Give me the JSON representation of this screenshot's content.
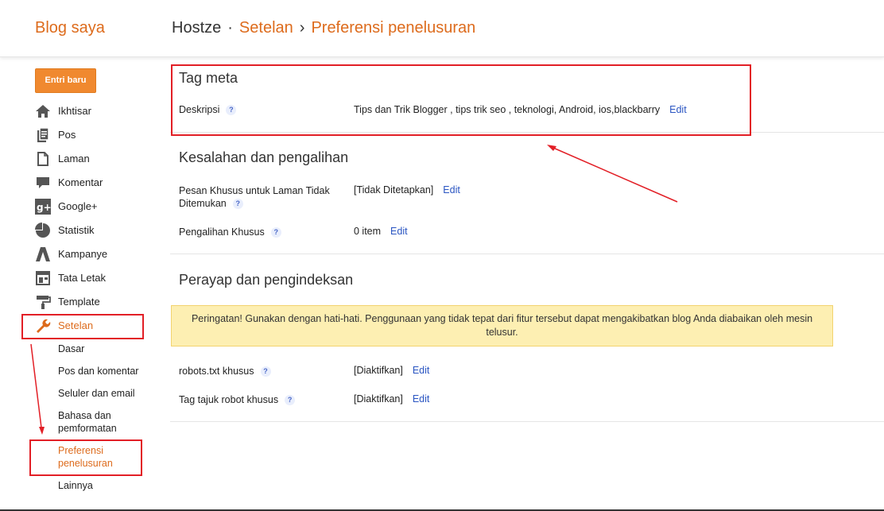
{
  "header": {
    "blog_title": "Blog saya",
    "breadcrumb": {
      "blog": "Hostze",
      "sep1": "·",
      "settings": "Setelan",
      "sep2": "›",
      "page": "Preferensi penelusuran"
    }
  },
  "sidebar": {
    "new_post": "Entri baru",
    "items": [
      {
        "label": "Ikhtisar",
        "icon": "home-icon"
      },
      {
        "label": "Pos",
        "icon": "posts-icon"
      },
      {
        "label": "Laman",
        "icon": "pages-icon"
      },
      {
        "label": "Komentar",
        "icon": "comment-icon"
      },
      {
        "label": "Google+",
        "icon": "google-plus-icon"
      },
      {
        "label": "Statistik",
        "icon": "pie-chart-icon"
      },
      {
        "label": "Kampanye",
        "icon": "campaign-icon"
      },
      {
        "label": "Tata Letak",
        "icon": "layout-icon"
      },
      {
        "label": "Template",
        "icon": "paint-roller-icon"
      },
      {
        "label": "Setelan",
        "icon": "wrench-icon"
      }
    ],
    "subitems": [
      "Dasar",
      "Pos dan komentar",
      "Seluler dan email",
      "Bahasa dan pemformatan",
      "Preferensi penelusuran",
      "Lainnya"
    ]
  },
  "main": {
    "meta_tags": {
      "title": "Tag meta",
      "description_label": "Deskripsi",
      "description_value": "Tips dan Trik Blogger , tips trik seo , teknologi, Android, ios,blackbarry",
      "edit": "Edit"
    },
    "errors": {
      "title": "Kesalahan dan pengalihan",
      "custom_404_label": "Pesan Khusus untuk Laman Tidak Ditemukan",
      "custom_404_value": "[Tidak Ditetapkan]",
      "redirects_label": "Pengalihan Khusus",
      "redirects_value": "0 item",
      "edit": "Edit"
    },
    "crawling": {
      "title": "Perayap dan pengindeksan",
      "warning": "Peringatan! Gunakan dengan hati-hati. Penggunaan yang tidak tepat dari fitur tersebut dapat mengakibatkan blog Anda diabaikan oleh mesin telusur.",
      "robots_label": "robots.txt khusus",
      "robots_value": "[Diaktifkan]",
      "robot_tags_label": "Tag tajuk robot khusus",
      "robot_tags_value": "[Diaktifkan]",
      "edit": "Edit"
    },
    "help_glyph": "?"
  },
  "colors": {
    "accent": "#dd6b1c",
    "button": "#f0892f",
    "link": "#2a55c2",
    "warning_bg": "#fdefb2",
    "annotation_red": "#e21f26"
  }
}
